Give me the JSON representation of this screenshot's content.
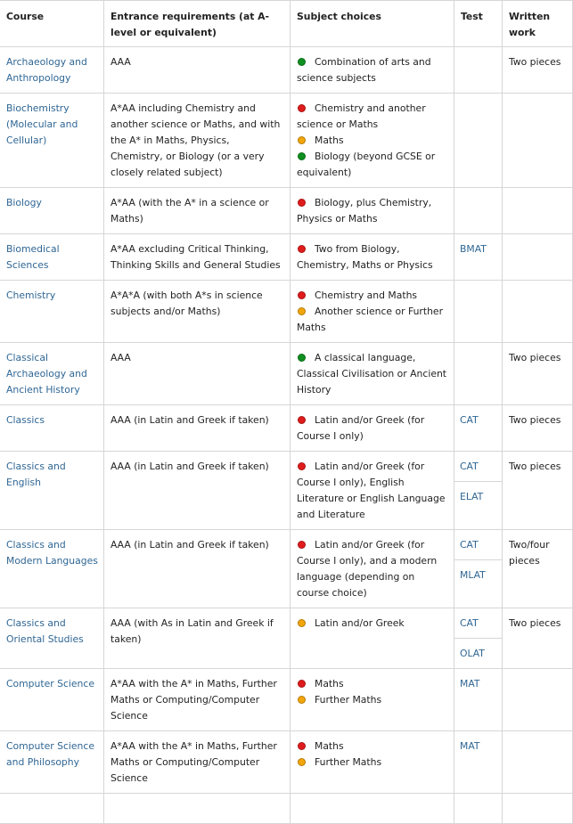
{
  "headers": {
    "course": "Course",
    "entrance": "Entrance requirements (at A-level or equivalent)",
    "subjects": "Subject choices",
    "test": "Test",
    "written": "Written work"
  },
  "colors": {
    "green": "#0f8f1f",
    "red": "#e01b1b",
    "amber": "#f2a60c",
    "link": "#2f6694"
  },
  "rows": [
    {
      "course": "Archaeology and Anthropology",
      "entrance": "AAA",
      "subjects": [
        {
          "level": "green",
          "text": "Combination of arts and science subjects"
        }
      ],
      "tests": [],
      "written": "Two pieces"
    },
    {
      "course": "Biochemistry (Molecular and Cellular)",
      "entrance": "A*AA including Chemistry and another science or Maths, and with the A* in Maths, Physics, Chemistry, or Biology (or a very closely related subject)",
      "subjects": [
        {
          "level": "red",
          "text": "Chemistry and another science or Maths"
        },
        {
          "level": "amber",
          "text": "Maths"
        },
        {
          "level": "green",
          "text": "Biology (beyond GCSE or equivalent)"
        }
      ],
      "tests": [],
      "written": ""
    },
    {
      "course": "Biology",
      "entrance": "A*AA (with the A* in a science or Maths)",
      "subjects": [
        {
          "level": "red",
          "text": "Biology, plus Chemistry, Physics or Maths"
        }
      ],
      "tests": [],
      "written": ""
    },
    {
      "course": "Biomedical Sciences",
      "entrance": "A*AA excluding Critical Thinking, Thinking Skills and General Studies",
      "subjects": [
        {
          "level": "red",
          "text": "Two from Biology, Chemistry, Maths or Physics"
        }
      ],
      "tests": [
        "BMAT"
      ],
      "written": ""
    },
    {
      "course": "Chemistry",
      "entrance": "A*A*A (with both A*s in science subjects and/or Maths)",
      "subjects": [
        {
          "level": "red",
          "text": "Chemistry and Maths"
        },
        {
          "level": "amber",
          "text": "Another science or Further Maths"
        }
      ],
      "tests": [],
      "written": ""
    },
    {
      "course": "Classical Archaeology and Ancient History",
      "entrance": "AAA",
      "subjects": [
        {
          "level": "green",
          "text": "A classical language, Classical Civilisation or Ancient History"
        }
      ],
      "tests": [],
      "written": "Two pieces"
    },
    {
      "course": "Classics",
      "entrance": "AAA (in Latin and Greek if taken)",
      "subjects": [
        {
          "level": "red",
          "text": "Latin and/or Greek (for Course I only)"
        }
      ],
      "tests": [
        "CAT"
      ],
      "written": "Two pieces"
    },
    {
      "course": "Classics and English",
      "entrance": "AAA (in Latin and Greek if taken)",
      "subjects": [
        {
          "level": "red",
          "text": "Latin and/or Greek (for Course I only), English Literature or English Language and Literature"
        }
      ],
      "tests": [
        "CAT",
        "ELAT"
      ],
      "written": "Two pieces"
    },
    {
      "course": "Classics and Modern Languages",
      "entrance": "AAA (in Latin and Greek if taken)",
      "subjects": [
        {
          "level": "red",
          "text": "Latin and/or Greek (for Course I only), and a modern language (depending on course choice)"
        }
      ],
      "tests": [
        "CAT",
        "MLAT"
      ],
      "written": "Two/four pieces"
    },
    {
      "course": "Classics and Oriental Studies",
      "entrance": "AAA (with As in Latin and Greek if taken)",
      "subjects": [
        {
          "level": "amber",
          "text": "Latin and/or Greek"
        }
      ],
      "tests": [
        "CAT",
        "OLAT"
      ],
      "written": "Two pieces"
    },
    {
      "course": "Computer Science",
      "entrance": "A*AA with the A* in Maths, Further Maths or Computing/Computer Science",
      "subjects": [
        {
          "level": "red",
          "text": "Maths"
        },
        {
          "level": "amber",
          "text": "Further Maths"
        }
      ],
      "tests": [
        "MAT"
      ],
      "written": ""
    },
    {
      "course": "Computer Science and Philosophy",
      "entrance": "A*AA with the A* in Maths, Further Maths or Computing/Computer Science",
      "subjects": [
        {
          "level": "red",
          "text": "Maths"
        },
        {
          "level": "amber",
          "text": "Further Maths"
        }
      ],
      "tests": [
        "MAT"
      ],
      "written": ""
    },
    {
      "course": "",
      "entrance": "",
      "subjects": [],
      "tests": [],
      "written": ""
    }
  ]
}
